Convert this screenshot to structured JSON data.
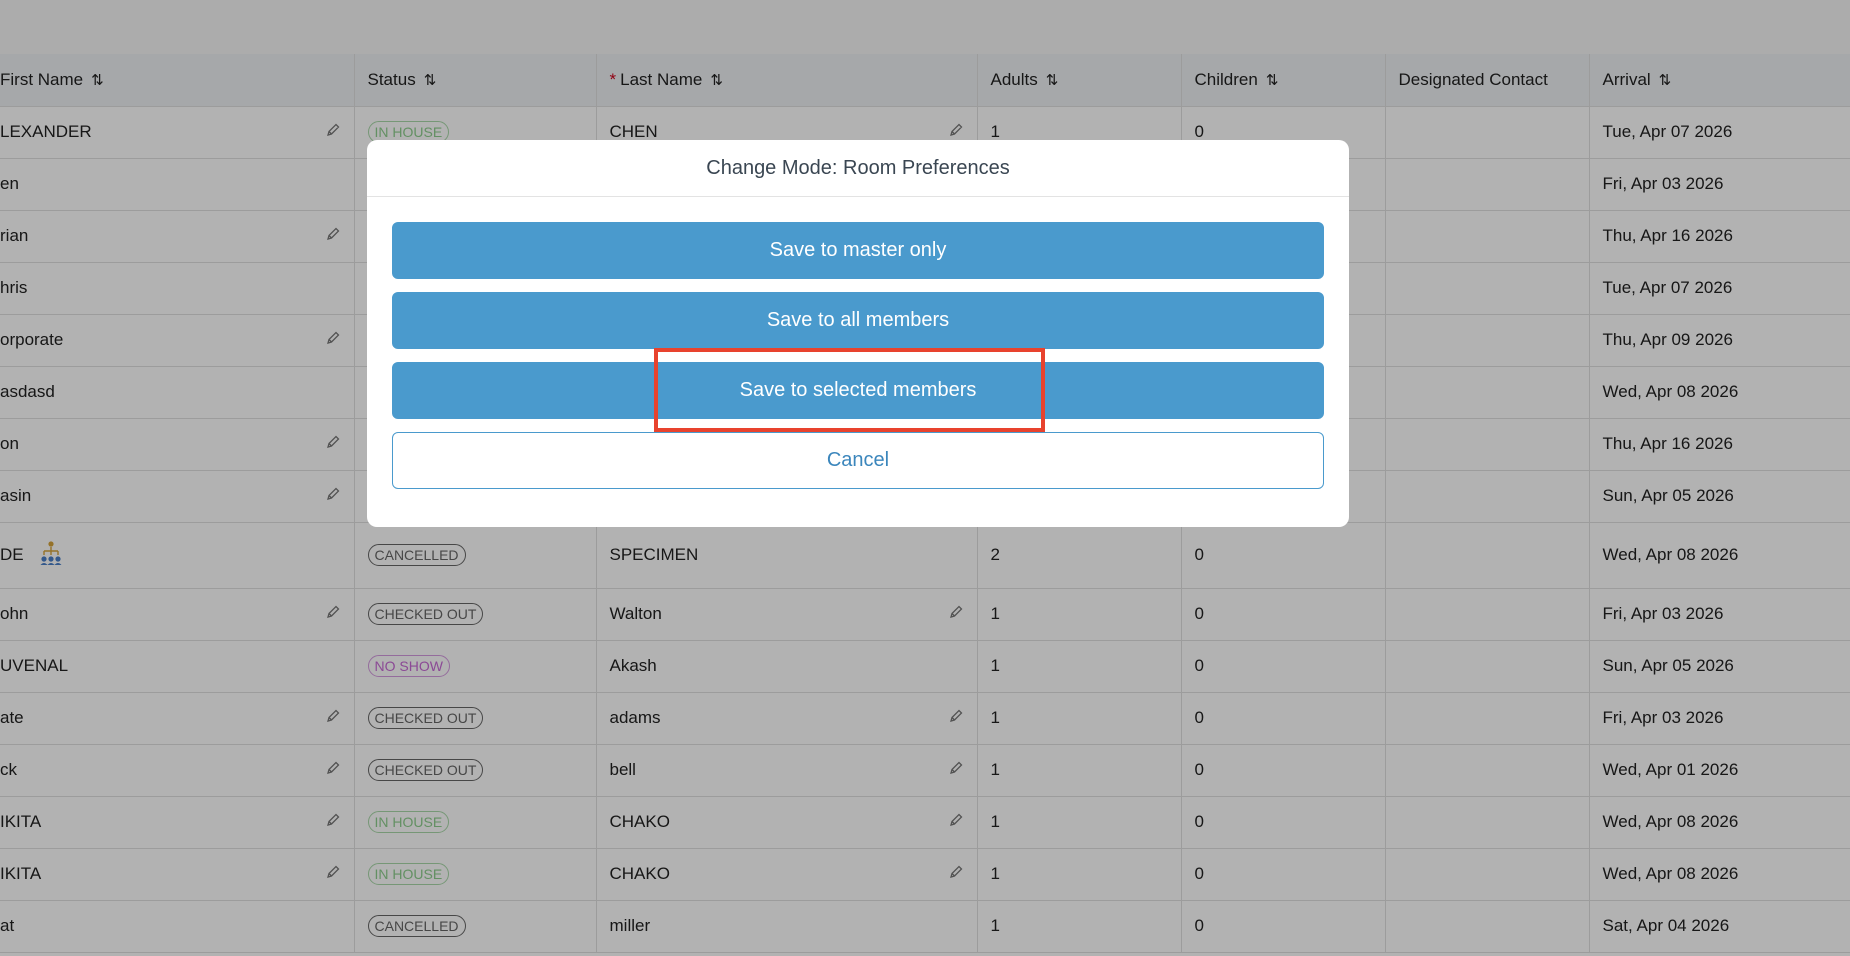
{
  "columns": {
    "first_name": "First Name",
    "status": "Status",
    "required_marker": "*",
    "last_name": "Last Name",
    "adults": "Adults",
    "children": "Children",
    "designated_contact": "Designated Contact",
    "arrival": "Arrival",
    "sort_icon": "⇅"
  },
  "rows": [
    {
      "first": "LEXANDER",
      "first_edit": true,
      "status": "IN HOUSE",
      "last": "CHEN",
      "last_edit": true,
      "adults": "1",
      "children": "0",
      "contact": "",
      "arrival": "Tue, Apr 07 2026"
    },
    {
      "first": "en",
      "first_edit": false,
      "status": "",
      "last": "",
      "last_edit": false,
      "adults": "",
      "children": "",
      "contact": "",
      "arrival": "Fri, Apr 03 2026"
    },
    {
      "first": "rian",
      "first_edit": true,
      "status": "",
      "last": "",
      "last_edit": false,
      "adults": "",
      "children": "",
      "contact": "",
      "arrival": "Thu, Apr 16 2026"
    },
    {
      "first": "hris",
      "first_edit": false,
      "status": "",
      "last": "",
      "last_edit": false,
      "adults": "",
      "children": "",
      "contact": "",
      "arrival": "Tue, Apr 07 2026"
    },
    {
      "first": "orporate",
      "first_edit": true,
      "status": "",
      "last": "",
      "last_edit": false,
      "adults": "",
      "children": "",
      "contact": "",
      "arrival": "Thu, Apr 09 2026"
    },
    {
      "first": "asdasd",
      "first_edit": false,
      "status": "",
      "last": "",
      "last_edit": false,
      "adults": "",
      "children": "",
      "contact": "",
      "arrival": "Wed, Apr 08 2026"
    },
    {
      "first": "on",
      "first_edit": true,
      "status": "",
      "last": "",
      "last_edit": false,
      "adults": "",
      "children": "",
      "contact": "",
      "arrival": "Thu, Apr 16 2026"
    },
    {
      "first": "asin",
      "first_edit": true,
      "status": "",
      "last": "",
      "last_edit": false,
      "adults": "",
      "children": "",
      "contact": "",
      "arrival": "Sun, Apr 05 2026"
    },
    {
      "first": "DE",
      "first_edit": false,
      "group_icon": true,
      "status": "CANCELLED",
      "last": "SPECIMEN",
      "last_edit": false,
      "adults": "2",
      "children": "0",
      "contact": "",
      "arrival": "Wed, Apr 08 2026"
    },
    {
      "first": "ohn",
      "first_edit": true,
      "status": "CHECKED OUT",
      "last": "Walton",
      "last_edit": true,
      "adults": "1",
      "children": "0",
      "contact": "",
      "arrival": "Fri, Apr 03 2026"
    },
    {
      "first": "UVENAL",
      "first_edit": false,
      "status": "NO SHOW",
      "last": "Akash",
      "last_edit": false,
      "adults": "1",
      "children": "0",
      "contact": "",
      "arrival": "Sun, Apr 05 2026"
    },
    {
      "first": "ate",
      "first_edit": true,
      "status": "CHECKED OUT",
      "last": "adams",
      "last_edit": true,
      "adults": "1",
      "children": "0",
      "contact": "",
      "arrival": "Fri, Apr 03 2026"
    },
    {
      "first": "ck",
      "first_edit": true,
      "status": "CHECKED OUT",
      "last": "bell",
      "last_edit": true,
      "adults": "1",
      "children": "0",
      "contact": "",
      "arrival": "Wed, Apr 01 2026"
    },
    {
      "first": "IKITA",
      "first_edit": true,
      "status": "IN HOUSE",
      "last": "CHAKO",
      "last_edit": true,
      "adults": "1",
      "children": "0",
      "contact": "",
      "arrival": "Wed, Apr 08 2026"
    },
    {
      "first": "IKITA",
      "first_edit": true,
      "status": "IN HOUSE",
      "last": "CHAKO",
      "last_edit": true,
      "adults": "1",
      "children": "0",
      "contact": "",
      "arrival": "Wed, Apr 08 2026"
    },
    {
      "first": "at",
      "first_edit": false,
      "status": "CANCELLED",
      "last": "miller",
      "last_edit": false,
      "adults": "1",
      "children": "0",
      "contact": "",
      "arrival": "Sat, Apr 04 2026"
    }
  ],
  "icons": {
    "edit": "pencil-icon",
    "group": "group-hierarchy-icon",
    "sort": "sort-arrows-icon"
  },
  "modal": {
    "title": "Change Mode: Room Preferences",
    "buttons": {
      "master_only": "Save to master only",
      "all_members": "Save to all members",
      "selected_members": "Save to selected members",
      "cancel": "Cancel"
    }
  },
  "colors": {
    "primary_button": "#4a9acd",
    "highlight": "#e8432e",
    "in_house": "#8fcf8f",
    "no_show": "#c86ad6"
  }
}
